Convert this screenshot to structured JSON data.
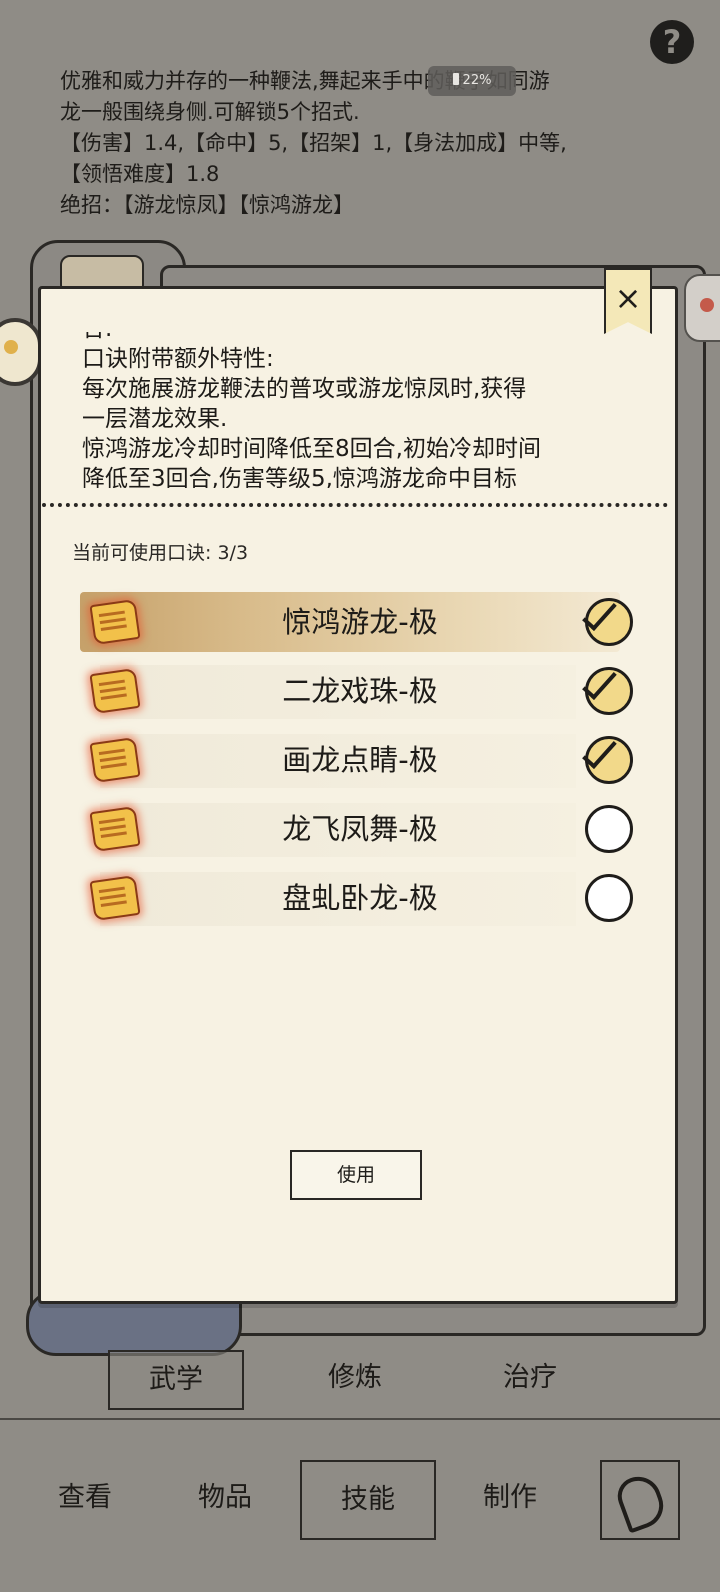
{
  "background": {
    "description_lines": [
      "优雅和威力并存的一种鞭法,舞起来手中的鞭子如同游",
      "龙一般围绕身侧.可解锁5个招式.",
      "【伤害】1.4,【命中】5,【招架】1,【身法加成】中等,",
      "【领悟难度】1.8",
      "绝招：【游龙惊凤】【惊鸿游龙】"
    ],
    "help_label": "?",
    "battery_percent": "22%"
  },
  "dialog": {
    "close_label": "×",
    "description_lines": [
      "合.",
      "口诀附带额外特性:",
      "每次施展游龙鞭法的普攻或游龙惊凤时,获得",
      "一层潜龙效果.",
      "惊鸿游龙冷却时间降低至8回合,初始冷却时间",
      "降低至3回合,伤害等级5,惊鸿游龙命中目标"
    ],
    "usage_label": "当前可使用口诀:",
    "usage_count": "3/3",
    "items": [
      {
        "label": "惊鸿游龙-极",
        "checked": true,
        "selected": true
      },
      {
        "label": "二龙戏珠-极",
        "checked": true,
        "selected": false
      },
      {
        "label": "画龙点睛-极",
        "checked": true,
        "selected": false
      },
      {
        "label": "龙飞凤舞-极",
        "checked": false,
        "selected": false
      },
      {
        "label": "盘虬卧龙-极",
        "checked": false,
        "selected": false
      }
    ],
    "use_button": "使用"
  },
  "subtabs": [
    "武学",
    "修炼",
    "治疗"
  ],
  "nav": [
    "查看",
    "物品",
    "技能",
    "制作"
  ]
}
